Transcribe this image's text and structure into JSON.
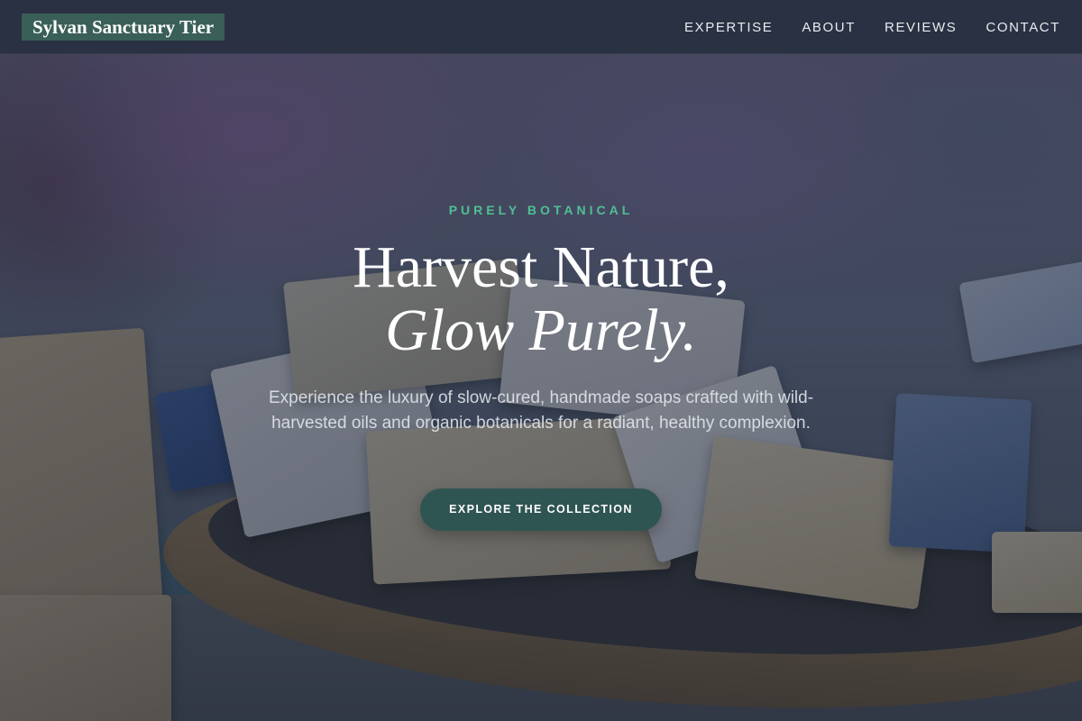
{
  "header": {
    "brand": "Sylvan Sanctuary Tier",
    "nav": [
      {
        "label": "EXPERTISE"
      },
      {
        "label": "ABOUT"
      },
      {
        "label": "REVIEWS"
      },
      {
        "label": "CONTACT"
      }
    ]
  },
  "hero": {
    "eyebrow": "PURELY BOTANICAL",
    "headline_line1": "Harvest Nature,",
    "headline_line2": "Glow Purely.",
    "subtext": "Experience the luxury of slow-cured, handmade soaps crafted with wild-harvested oils and organic botanicals for a radiant, healthy complexion.",
    "cta_label": "EXPLORE THE COLLECTION"
  },
  "colors": {
    "accent_green": "#4fbf95",
    "button_teal": "#2f5552",
    "brand_bg": "#3a5f58",
    "nav_bg": "#283040"
  }
}
